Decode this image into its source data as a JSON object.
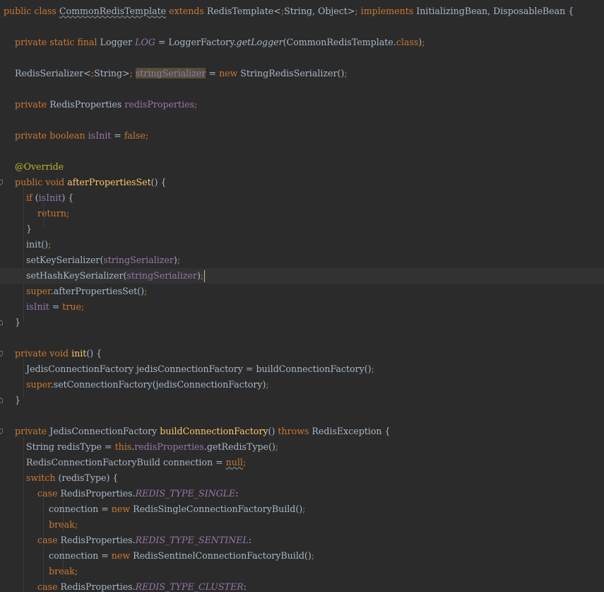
{
  "lines": [
    {
      "text": "public class CommonRedisTemplate extends RedisTemplate<String, Object> implements InitializingBean, DisposableBean {"
    },
    {
      "text": ""
    },
    {
      "text": "    private static final Logger LOG = LoggerFactory.getLogger(CommonRedisTemplate.class);"
    },
    {
      "text": ""
    },
    {
      "text": "    RedisSerializer<String> stringSerializer = new StringRedisSerializer();"
    },
    {
      "text": ""
    },
    {
      "text": "    private RedisProperties redisProperties;"
    },
    {
      "text": ""
    },
    {
      "text": "    private boolean isInit = false;"
    },
    {
      "text": ""
    },
    {
      "text": "    @Override"
    },
    {
      "text": "    public void afterPropertiesSet() {"
    },
    {
      "text": "        if (isInit) {"
    },
    {
      "text": "            return;"
    },
    {
      "text": "        }"
    },
    {
      "text": "        init();"
    },
    {
      "text": "        setKeySerializer(stringSerializer);"
    },
    {
      "text": "        setHashKeySerializer(stringSerializer);"
    },
    {
      "text": "        super.afterPropertiesSet();"
    },
    {
      "text": "        isInit = true;"
    },
    {
      "text": "    }"
    },
    {
      "text": ""
    },
    {
      "text": "    private void init() {"
    },
    {
      "text": "        JedisConnectionFactory jedisConnectionFactory = buildConnectionFactory();"
    },
    {
      "text": "        super.setConnectionFactory(jedisConnectionFactory);"
    },
    {
      "text": "    }"
    },
    {
      "text": ""
    },
    {
      "text": "    private JedisConnectionFactory buildConnectionFactory() throws RedisException {"
    },
    {
      "text": "        String redisType = this.redisProperties.getRedisType();"
    },
    {
      "text": "        RedisConnectionFactoryBuild connection = null;"
    },
    {
      "text": "        switch (redisType) {"
    },
    {
      "text": "            case RedisProperties.REDIS_TYPE_SINGLE:"
    },
    {
      "text": "                connection = new RedisSingleConnectionFactoryBuild();"
    },
    {
      "text": "                break;"
    },
    {
      "text": "            case RedisProperties.REDIS_TYPE_SENTINEL:"
    },
    {
      "text": "                connection = new RedisSentinelConnectionFactoryBuild();"
    },
    {
      "text": "                break;"
    },
    {
      "text": "            case RedisProperties.REDIS_TYPE_CLUSTER:"
    }
  ],
  "colors": {
    "background": "#2b2b2b",
    "keyword": "#cc7832",
    "method_declaration": "#ffc66d",
    "field": "#9876aa",
    "annotation": "#bbb529",
    "plain": "#a9b7c6",
    "current_line": "#323232",
    "highlight": "#52503a"
  },
  "editor": {
    "current_line": 17,
    "highlighted_identifier": "stringSerializer",
    "fold_markers": [
      "fold-marker-icon",
      "fold-end-icon"
    ]
  }
}
